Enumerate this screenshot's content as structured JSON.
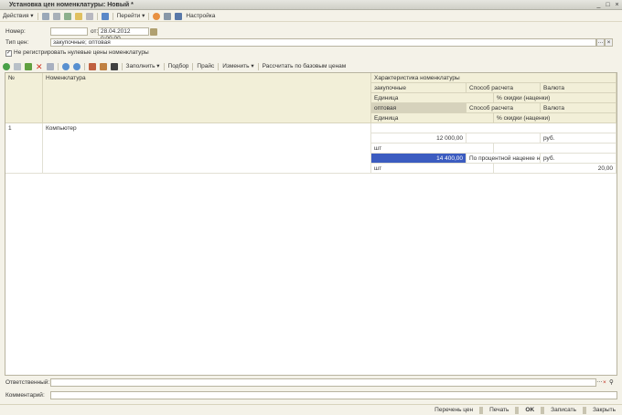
{
  "window": {
    "title": "Установка цен номенклатуры: Новый *"
  },
  "toolbar": {
    "actions": "Действия ▾",
    "goto": "Перейти ▾",
    "settings": "Настройка"
  },
  "form": {
    "number_label": "Номер:",
    "number_value": "",
    "date_label": "от:",
    "date_value": "28.04.2012  0:00:00",
    "price_type_label": "Тип цен:",
    "price_type_value": "закупочные; оптовая",
    "checkbox_label": "Не регистрировать нулевые цены номенклатуры",
    "checkbox_checked": true
  },
  "table_toolbar": {
    "fill": "Заполнить ▾",
    "pick": "Подбор",
    "price": "Прайс",
    "change": "Изменить ▾",
    "calc": "Рассчитать по базовым ценам"
  },
  "table": {
    "headers": {
      "num": "№",
      "item": "Номенклатура",
      "char": "Характеристика номенклатуры",
      "pt1": "закупочные",
      "method": "Способ расчета",
      "currency": "Валюта",
      "unit": "Единица",
      "discount": "% скидки (наценки)",
      "pt2": "оптовая"
    },
    "rows": [
      {
        "num": "1",
        "item": "Компьютер",
        "char": "",
        "price1": "12 000,00",
        "method1": "",
        "currency1": "руб.",
        "unit1": "шт",
        "discount1": "",
        "price2": "14 400,00",
        "method2": "По процентной наценке на...",
        "currency2": "руб.",
        "unit2": "шт",
        "discount2": "20,00"
      }
    ]
  },
  "footer": {
    "responsible_label": "Ответственный:",
    "responsible_value": "",
    "comment_label": "Комментарий:",
    "comment_value": ""
  },
  "bottom": {
    "price_list": "Перечень цен",
    "print": "Печать",
    "ok": "OK",
    "save": "Записать",
    "close": "Закрыть"
  }
}
